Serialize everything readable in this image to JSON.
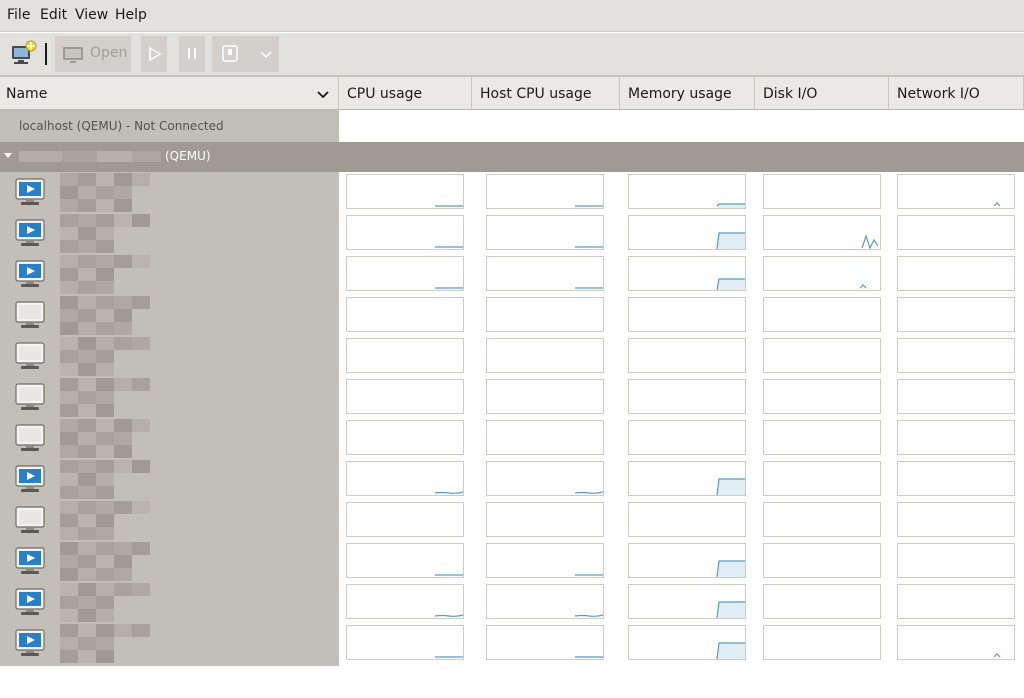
{
  "menu": [
    "File",
    "Edit",
    "View",
    "Help"
  ],
  "toolbar": {
    "new_vm": {
      "icon": "new-vm-icon",
      "enabled": true
    },
    "open": {
      "label": "Open",
      "icon": "monitor-icon",
      "enabled": false
    },
    "run": {
      "icon": "play-icon",
      "enabled": false
    },
    "pause": {
      "icon": "pause-icon",
      "enabled": false
    },
    "shutdown": {
      "icon": "power-icon",
      "enabled": false
    },
    "shutdown_menu": {
      "icon": "chevron-down-icon",
      "enabled": false
    }
  },
  "columns": {
    "name": "Name",
    "cpu": "CPU usage",
    "host_cpu": "Host CPU usage",
    "memory": "Memory usage",
    "disk": "Disk I/O",
    "network": "Network I/O"
  },
  "connections": [
    {
      "label": "localhost (QEMU) - Not Connected"
    },
    {
      "label": "(QEMU)",
      "expanded": true
    }
  ],
  "colors": {
    "name_column_bg": "#c2bfb8",
    "group_row_bg": "#9f9b94",
    "sparkline_stroke": "#5b9bc0",
    "sparkline_fill": "#e2eef5",
    "running_icon_blue": "#2a7fc9"
  },
  "vms": [
    {
      "state": "running",
      "cpu": "low",
      "host_cpu": "low",
      "memory": "low-flat",
      "disk": "none",
      "network": "blip"
    },
    {
      "state": "running",
      "cpu": "low",
      "host_cpu": "low",
      "memory": "step-high",
      "disk": "spikes",
      "network": "none"
    },
    {
      "state": "running",
      "cpu": "low",
      "host_cpu": "low",
      "memory": "step-mid",
      "disk": "blip",
      "network": "none"
    },
    {
      "state": "shutoff",
      "cpu": "none",
      "host_cpu": "none",
      "memory": "none",
      "disk": "none",
      "network": "none"
    },
    {
      "state": "shutoff",
      "cpu": "none",
      "host_cpu": "none",
      "memory": "none",
      "disk": "none",
      "network": "none"
    },
    {
      "state": "shutoff",
      "cpu": "none",
      "host_cpu": "none",
      "memory": "none",
      "disk": "none",
      "network": "none"
    },
    {
      "state": "shutoff",
      "cpu": "none",
      "host_cpu": "none",
      "memory": "none",
      "disk": "none",
      "network": "none"
    },
    {
      "state": "running",
      "cpu": "low-wave",
      "host_cpu": "low-wave",
      "memory": "step-high",
      "disk": "none",
      "network": "none"
    },
    {
      "state": "shutoff",
      "cpu": "none",
      "host_cpu": "none",
      "memory": "none",
      "disk": "none",
      "network": "none"
    },
    {
      "state": "running",
      "cpu": "low",
      "host_cpu": "low",
      "memory": "step-high",
      "disk": "none",
      "network": "none"
    },
    {
      "state": "running",
      "cpu": "low-wave",
      "host_cpu": "low-wave",
      "memory": "step-high",
      "disk": "none",
      "network": "none"
    },
    {
      "state": "running",
      "cpu": "low",
      "host_cpu": "low",
      "memory": "step-high",
      "disk": "none",
      "network": "blip"
    }
  ]
}
